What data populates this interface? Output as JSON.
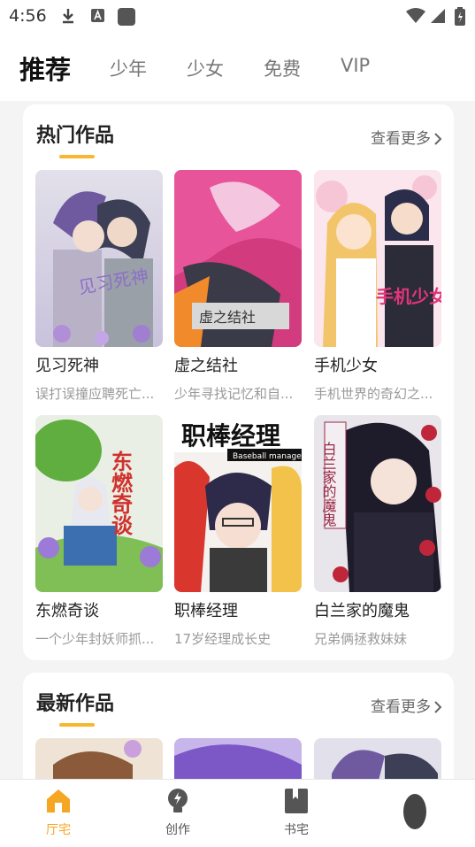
{
  "status_bar": {
    "time": "4:56"
  },
  "top_tabs": [
    "推荐",
    "少年",
    "少女",
    "免费",
    "VIP"
  ],
  "hot_section": {
    "title": "热门作品",
    "more": "查看更多",
    "items": [
      {
        "title": "见习死神",
        "desc": "误打误撞应聘死亡...",
        "cover_text": "见习死神"
      },
      {
        "title": "虚之结社",
        "desc": "少年寻找记忆和自...",
        "cover_text": "虚之结社"
      },
      {
        "title": "手机少女",
        "desc": "手机世界的奇幻之...",
        "cover_text": "手机少女"
      },
      {
        "title": "东燃奇谈",
        "desc": "一个少年封妖师抓...",
        "cover_text": "东燃奇谈"
      },
      {
        "title": "职棒经理",
        "desc": "17岁经理成长史",
        "cover_text": "职棒经理",
        "cover_subtext": "Baseball manager"
      },
      {
        "title": "白兰家的魔鬼",
        "desc": "兄弟俩拯救妹妹",
        "cover_text": "白兰家的魔鬼"
      }
    ]
  },
  "new_section": {
    "title": "最新作品",
    "more": "查看更多"
  },
  "bottom_nav": [
    "厅宅",
    "创作",
    "书宅",
    ""
  ],
  "colors": {
    "accent": "#f5a623",
    "underline": "#f7b731"
  }
}
